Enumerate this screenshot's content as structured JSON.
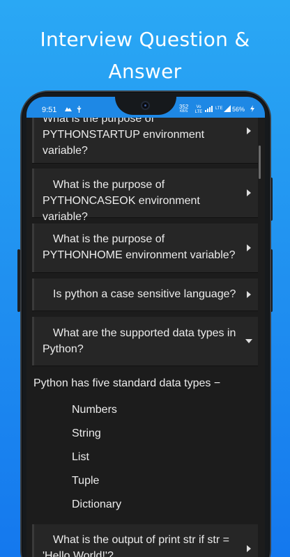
{
  "promo": {
    "title_line1": "Interview Question &",
    "title_line2": "Answer"
  },
  "status_bar": {
    "time": "9:51",
    "net_speed_value": "352",
    "net_speed_unit": "KB/S",
    "network_type": "Vo LTE",
    "signal_label": "LTE",
    "battery": "56%",
    "color": "#1e88e5"
  },
  "questions": [
    {
      "text": "What is the purpose of PYTHONSTARTUP environment variable?",
      "expanded": false
    },
    {
      "text": "What is the purpose of PYTHONCASEOK environment variable?",
      "expanded": false
    },
    {
      "text": "What is the purpose of PYTHONHOME environment variable?",
      "expanded": false
    },
    {
      "text": "Is python a case sensitive language?",
      "expanded": false
    },
    {
      "text": "What are the supported data types in Python?",
      "expanded": true
    },
    {
      "text": "What is the output of print str if str = 'Hello World!'?",
      "expanded": false
    }
  ],
  "answer": {
    "intro": "Python has five standard data types −",
    "items": [
      "Numbers",
      "String",
      "List",
      "Tuple",
      "Dictionary"
    ]
  },
  "icons": {
    "collapsed": "chevron-right-icon",
    "expanded": "chevron-down-icon"
  },
  "colors": {
    "background_top": "#2aa8f4",
    "background_bottom": "#1478ee",
    "card": "#262626",
    "screen": "#1c1c1c"
  }
}
